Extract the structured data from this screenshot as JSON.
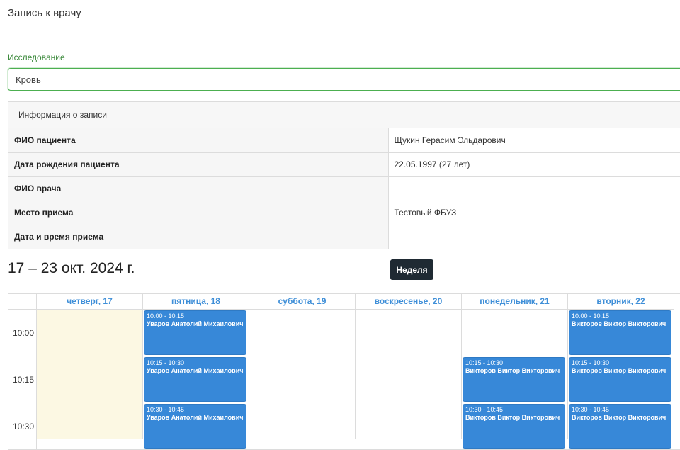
{
  "page": {
    "title": "Запись к врачу"
  },
  "study": {
    "label": "Исследование",
    "value": "Кровь"
  },
  "info": {
    "header": "Информация о записи",
    "rows": [
      {
        "key": "ФИО пациента",
        "value": "Щукин Герасим Эльдарович"
      },
      {
        "key": "Дата рождения пациента",
        "value": "22.05.1997 (27 лет)"
      },
      {
        "key": "ФИО врача",
        "value": ""
      },
      {
        "key": "Место приема",
        "value": "Тестовый ФБУЗ"
      },
      {
        "key": "Дата и время приема",
        "value": ""
      }
    ]
  },
  "calendar": {
    "range_title": "17 – 23 окт. 2024 г.",
    "view_button": "Неделя",
    "days": [
      "четверг, 17",
      "пятница, 18",
      "суббота, 19",
      "воскресенье, 20",
      "понедельник, 21",
      "вторник, 22"
    ],
    "times": [
      "10:00",
      "10:15",
      "10:30"
    ],
    "events": [
      {
        "day": 1,
        "slot": 0,
        "time": "10:00 - 10:15",
        "name": "Уваров Анатолий Михаилович"
      },
      {
        "day": 1,
        "slot": 1,
        "time": "10:15 - 10:30",
        "name": "Уваров Анатолий Михаилович"
      },
      {
        "day": 1,
        "slot": 2,
        "time": "10:30 - 10:45",
        "name": "Уваров Анатолий Михаилович"
      },
      {
        "day": 4,
        "slot": 1,
        "time": "10:15 - 10:30",
        "name": "Викторов Виктор Викторович"
      },
      {
        "day": 4,
        "slot": 2,
        "time": "10:30 - 10:45",
        "name": "Викторов Виктор Викторович"
      },
      {
        "day": 5,
        "slot": 0,
        "time": "10:00 - 10:15",
        "name": "Викторов Виктор Викторович"
      },
      {
        "day": 5,
        "slot": 1,
        "time": "10:15 - 10:30",
        "name": "Викторов Виктор Викторович"
      },
      {
        "day": 5,
        "slot": 2,
        "time": "10:30 - 10:45",
        "name": "Викторов Виктор Викторович"
      }
    ],
    "colors": {
      "event": "#3788d8",
      "today": "#fcf8e3",
      "header_text": "#3f8fd8"
    }
  }
}
